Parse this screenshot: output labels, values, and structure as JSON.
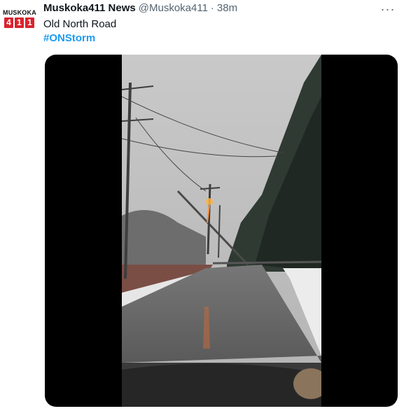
{
  "tweet": {
    "avatar": {
      "brand_text": "MUSKOKA",
      "digits": [
        "4",
        "1",
        "1"
      ],
      "brand_color": "#d9232d"
    },
    "display_name": "Muskoka411 News",
    "handle": "@Muskoka411",
    "separator": "·",
    "time": "38m",
    "more_icon": "···",
    "text": "Old North Road",
    "hashtag": "#ONStorm",
    "hashtag_color": "#1d9bf0",
    "media": {
      "type": "video",
      "description_icon": "storm-road-video"
    }
  }
}
